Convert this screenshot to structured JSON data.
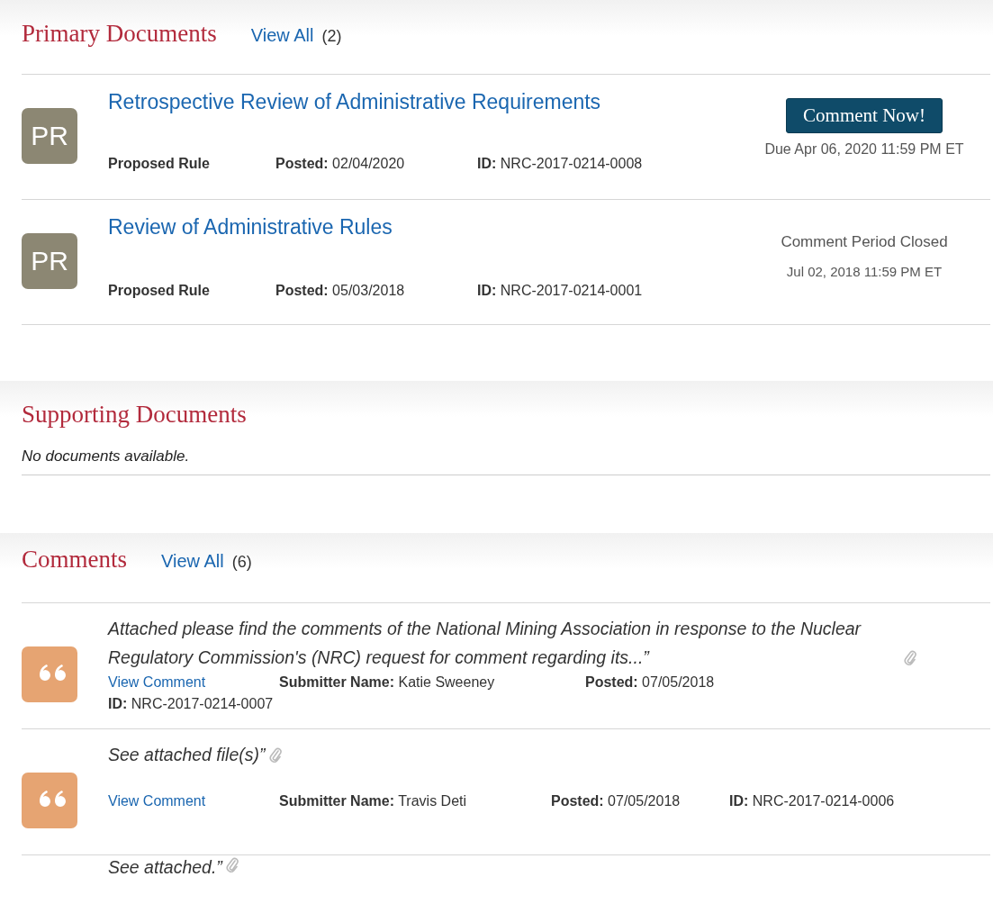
{
  "primary_documents": {
    "title": "Primary Documents",
    "view_all": "View All",
    "count": "(2)",
    "items": [
      {
        "badge": "PR",
        "title": "Retrospective Review of Administrative Requirements",
        "type": "Proposed Rule",
        "posted": "**Posted:** 02/04/2020",
        "id": "**ID:** NRC-2017-0214-0008",
        "kind": "open",
        "action": "Comment Now!",
        "due": "Due Apr 06, 2020 11:59 PM ET"
      },
      {
        "badge": "PR",
        "title": "Review of Administrative Rules",
        "type": "Proposed Rule",
        "posted": "**Posted:** 05/03/2018",
        "id": "**ID:** NRC-2017-0214-0001",
        "kind": "closed",
        "closed_label": "Comment Period Closed",
        "due": "Jul 02, 2018 11:59 PM ET"
      }
    ]
  },
  "supporting_documents": {
    "title": "Supporting Documents",
    "empty_message": "No documents available."
  },
  "comments": {
    "title": "Comments",
    "view_all": "View All",
    "count": "(6)",
    "items": [
      {
        "text": "Attached please find the comments of the National Mining Association in response to the Nuclear Regulatory Commission's (NRC) request for comment regarding its...”",
        "link": "View Comment",
        "meta_lines": [
          [
            "**Submitter Name:** Katie Sweeney",
            "**Posted:** 07/05/2018"
          ],
          [
            "**ID:** NRC-2017-0214-0007"
          ]
        ]
      },
      {
        "text": "See attached file(s)”",
        "link": "View Comment",
        "meta_lines": [
          [
            "**Submitter Name:** Travis Deti",
            "**Posted:** 07/05/2018",
            "**ID:** NRC-2017-0214-0006"
          ]
        ]
      },
      {
        "text": "See attached.”"
      }
    ]
  }
}
